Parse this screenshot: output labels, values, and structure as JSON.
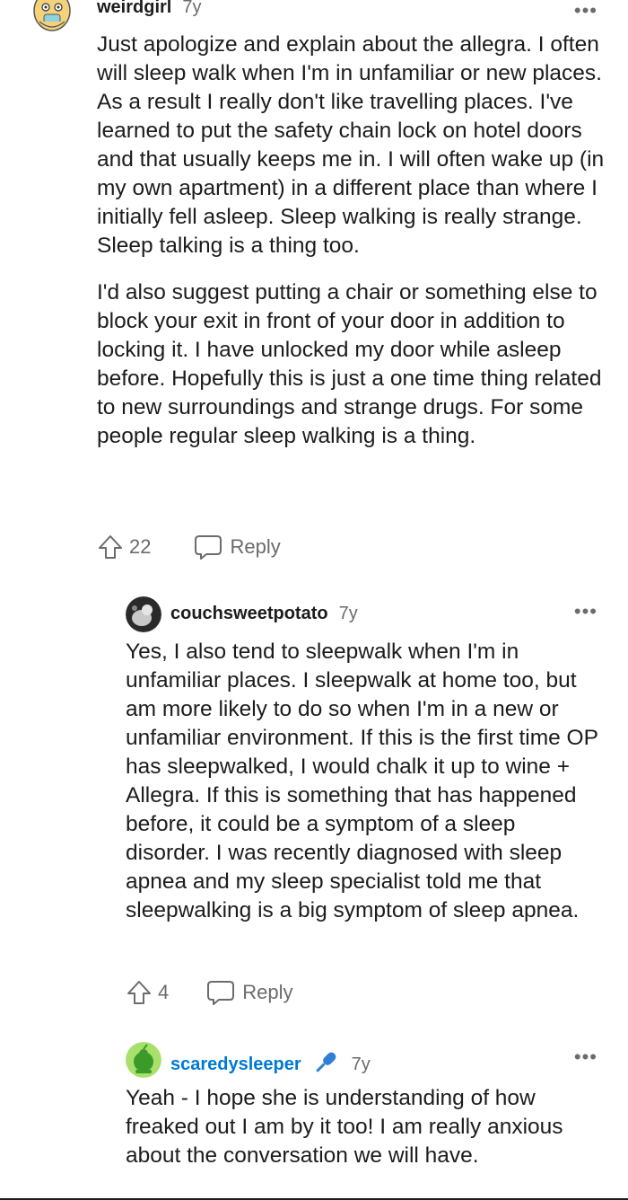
{
  "comments": [
    {
      "username": "weirdgirl",
      "age": "7y",
      "more": "•••",
      "paragraphs": [
        "Just apologize and explain about the allegra. I often will sleep walk when I'm in unfamiliar or new places. As a result I really don't like travelling places. I've learned to put the safety chain lock on hotel doors and that usually keeps me in. I will often wake up (in my own apartment) in a different place than where I initially fell asleep. Sleep walking is really strange. Sleep talking is a thing too.",
        "I'd also suggest putting a chair or something else to block your exit in front of your door in addition to locking it. I have unlocked my door while asleep before. Hopefully this is just a one time thing related to new surroundings and strange drugs. For some people regular sleep walking is a thing."
      ],
      "votes": "22",
      "reply_label": "Reply"
    },
    {
      "username": "couchsweetpotato",
      "age": "7y",
      "more": "•••",
      "paragraphs": [
        "Yes, I also tend to sleepwalk when I'm in unfamiliar places. I sleepwalk at home too, but am more likely to do so when I'm in a new or unfamiliar environment. If this is the first time OP has sleepwalked, I would chalk it up to wine + Allegra. If this is something that has happened before, it could be a symptom of a sleep disorder. I was recently diagnosed with sleep apnea and my sleep specialist told me that sleepwalking is a big symptom of sleep apnea."
      ],
      "votes": "4",
      "reply_label": "Reply"
    },
    {
      "username": "scaredysleeper",
      "age": "7y",
      "more": "•••",
      "paragraphs": [
        "Yeah - I hope she is understanding of how freaked out I am by it too! I am really anxious about the conversation we will have."
      ]
    }
  ],
  "colors": {
    "op_username": "#0079d3",
    "mic_icon": "#2f7fd6",
    "secondary_text": "#6b6b6b"
  }
}
